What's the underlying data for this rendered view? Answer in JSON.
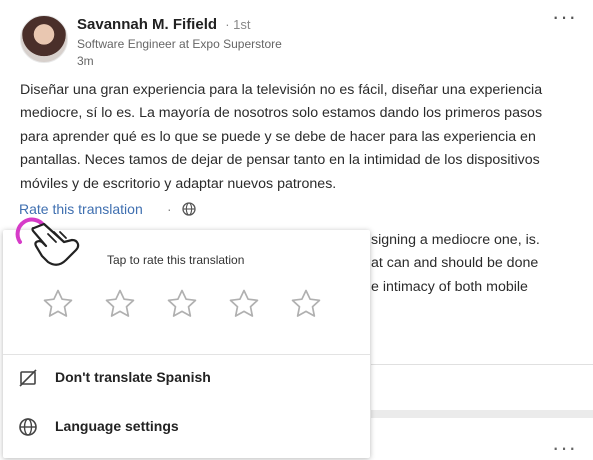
{
  "post": {
    "author_name": "Savannah M. Fifield",
    "connection_degree": "· 1st",
    "headline": "Software Engineer at Expo Superstore",
    "time_ago": "3m",
    "translated_text": "Diseñar una gran experiencia para la televisión no es fácil, diseñar una experiencia mediocre, sí lo es. La mayoría de nosotros solo estamos dando los primeros pasos para aprender qué es lo que se puede y se debe de hacer para las experiencia en pantallas. Neces tamos de dejar de pensar tanto en la intimidad de los dispositivos móviles y de escritorio y adaptar nuevos patrones.",
    "rate_link": "Rate this translation",
    "rate_separator": "·",
    "original_text_fragments": [
      "signing a mediocre one, is.",
      "at can and should be done",
      "e intimacy of both mobile"
    ]
  },
  "rating_popup": {
    "title": "Tap to rate this translation",
    "star_count": 5,
    "rating": 0
  },
  "menu": {
    "items": [
      {
        "label": "Don't translate Spanish",
        "icon": "no-translate-icon"
      },
      {
        "label": "Language settings",
        "icon": "globe-icon"
      }
    ]
  },
  "colors": {
    "link": "#3f6fb0",
    "touch_accent": "#d63bc8",
    "star_outline": "#b0b0b0"
  }
}
